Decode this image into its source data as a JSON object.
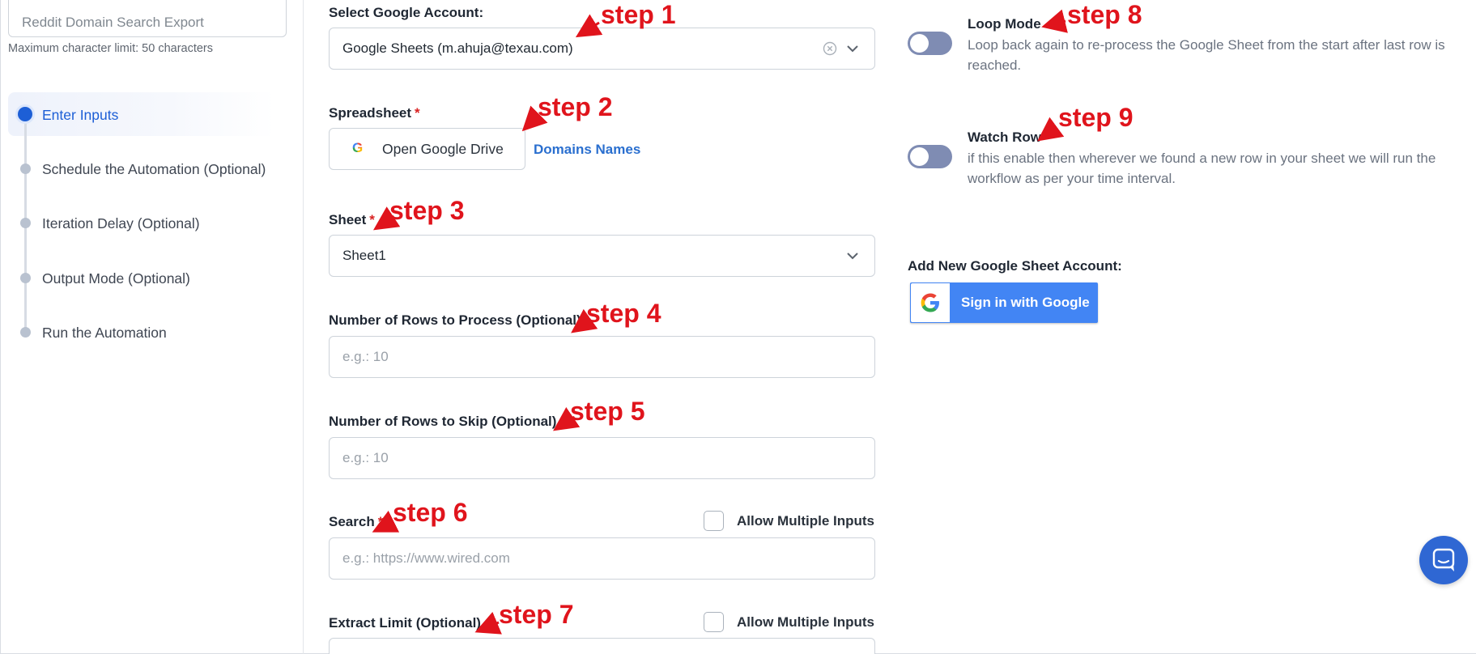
{
  "sidebar": {
    "name_placeholder": "Reddit Domain Search Export",
    "char_hint": "Maximum character limit: 50 characters",
    "steps": [
      {
        "label": "Enter Inputs",
        "active": true
      },
      {
        "label": "Schedule the Automation (Optional)",
        "active": false
      },
      {
        "label": "Iteration Delay (Optional)",
        "active": false
      },
      {
        "label": "Output Mode (Optional)",
        "active": false
      },
      {
        "label": "Run the Automation",
        "active": false
      }
    ]
  },
  "form": {
    "account_label": "Select Google Account:",
    "account_value": "Google Sheets (m.ahuja@texau.com)",
    "spreadsheet_label": "Spreadsheet",
    "drive_button": "Open Google Drive",
    "drive_icon_letter": "G",
    "spreadsheet_link": "Domains Names",
    "sheet_label": "Sheet",
    "sheet_value": "Sheet1",
    "rows_process_label": "Number of Rows to Process (Optional)",
    "rows_process_placeholder": "e.g.: 10",
    "rows_skip_label": "Number of Rows to Skip (Optional)",
    "rows_skip_placeholder": "e.g.: 10",
    "search_label": "Search",
    "search_placeholder": "e.g.: https://www.wired.com",
    "extract_label": "Extract Limit (Optional)",
    "allow_multiple_label": "Allow Multiple Inputs",
    "required_mark": "*"
  },
  "options": {
    "loop_title": "Loop Mode",
    "loop_desc": "Loop back again to re-process the Google Sheet from the start after last row is reached.",
    "loop_on": false,
    "watch_title": "Watch Row",
    "watch_desc": "if this enable then wherever we found a new row in your sheet we will run the workflow as per your time interval.",
    "watch_on": false,
    "add_account_label": "Add New Google Sheet Account:",
    "google_signin": "Sign in with Google"
  },
  "annotations": [
    "step 1",
    "step 2",
    "step 3",
    "step 4",
    "step 5",
    "step 6",
    "step 7",
    "step 8",
    "step 9"
  ],
  "colors": {
    "accent": "#1d5fd6",
    "link": "#2a6fcf",
    "required": "#d92121",
    "annotation": "#e0141c",
    "toggle_off": "#7f8cb3",
    "google_blue": "#4285f4",
    "chat_button": "#2f67d3"
  },
  "icons": {
    "account_clear": "circle-x-icon",
    "dropdown": "chevron-down-icon",
    "google": "google-g-icon",
    "chat": "chat-bubble-icon"
  }
}
